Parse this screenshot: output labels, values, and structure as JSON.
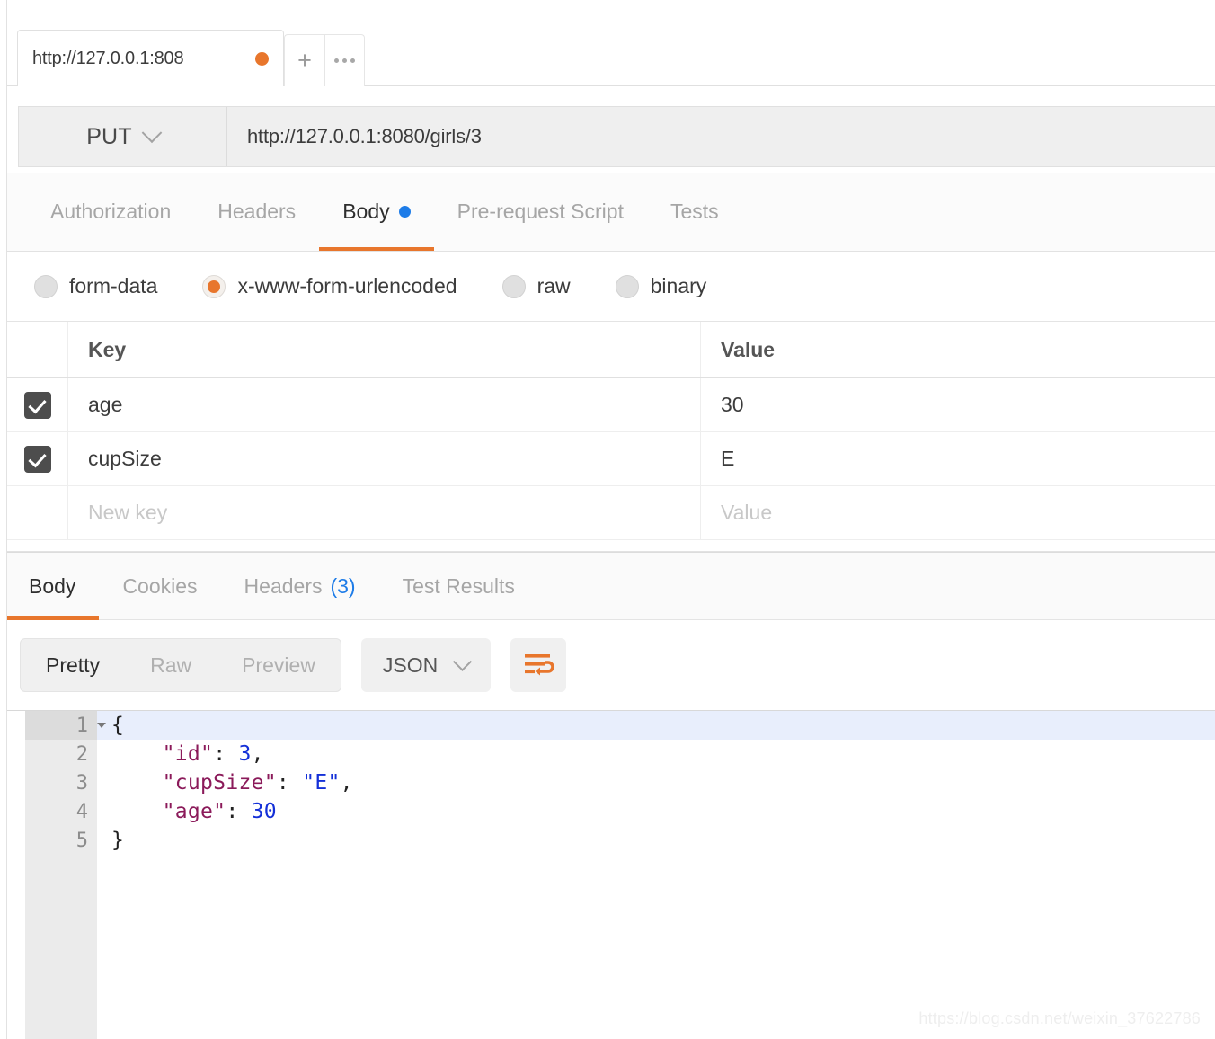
{
  "tabbar": {
    "tabs": [
      {
        "title": "http://127.0.0.1:808",
        "unsaved": true
      }
    ],
    "new_tab_label": "+",
    "more_label": "•••"
  },
  "request": {
    "method": "PUT",
    "url": "http://127.0.0.1:8080/girls/3",
    "tabs": [
      {
        "label": "Authorization",
        "active": false,
        "dot": false
      },
      {
        "label": "Headers",
        "active": false,
        "dot": false
      },
      {
        "label": "Body",
        "active": true,
        "dot": true
      },
      {
        "label": "Pre-request Script",
        "active": false,
        "dot": false
      },
      {
        "label": "Tests",
        "active": false,
        "dot": false
      }
    ],
    "body_types": [
      {
        "label": "form-data",
        "selected": false
      },
      {
        "label": "x-www-form-urlencoded",
        "selected": true
      },
      {
        "label": "raw",
        "selected": false
      },
      {
        "label": "binary",
        "selected": false
      }
    ],
    "table": {
      "headers": {
        "key": "Key",
        "value": "Value"
      },
      "rows": [
        {
          "checked": true,
          "key": "age",
          "value": "30"
        },
        {
          "checked": true,
          "key": "cupSize",
          "value": "E"
        }
      ],
      "new_row": {
        "key_placeholder": "New key",
        "value_placeholder": "Value"
      }
    }
  },
  "response": {
    "tabs": [
      {
        "label": "Body",
        "active": true,
        "count": ""
      },
      {
        "label": "Cookies",
        "active": false,
        "count": ""
      },
      {
        "label": "Headers",
        "active": false,
        "count": "(3)"
      },
      {
        "label": "Test Results",
        "active": false,
        "count": ""
      }
    ],
    "view_modes": [
      {
        "label": "Pretty",
        "active": true
      },
      {
        "label": "Raw",
        "active": false
      },
      {
        "label": "Preview",
        "active": false
      }
    ],
    "format": "JSON",
    "wrap_icon": "word-wrap-icon",
    "code": {
      "lines": [
        {
          "num": "1",
          "fold": true,
          "text": "{"
        },
        {
          "num": "2",
          "fold": false,
          "text": "    \"id\": 3,"
        },
        {
          "num": "3",
          "fold": false,
          "text": "    \"cupSize\": \"E\","
        },
        {
          "num": "4",
          "fold": false,
          "text": "    \"age\": 30"
        },
        {
          "num": "5",
          "fold": false,
          "text": "}"
        }
      ]
    }
  },
  "watermark": "https://blog.csdn.net/weixin_37622786",
  "colors": {
    "accent_orange": "#e8762c",
    "info_blue": "#1d7ce8",
    "checkbox_gray": "#4d4d4d",
    "json_key": "#8b1a5a",
    "json_value": "#1430d8"
  }
}
